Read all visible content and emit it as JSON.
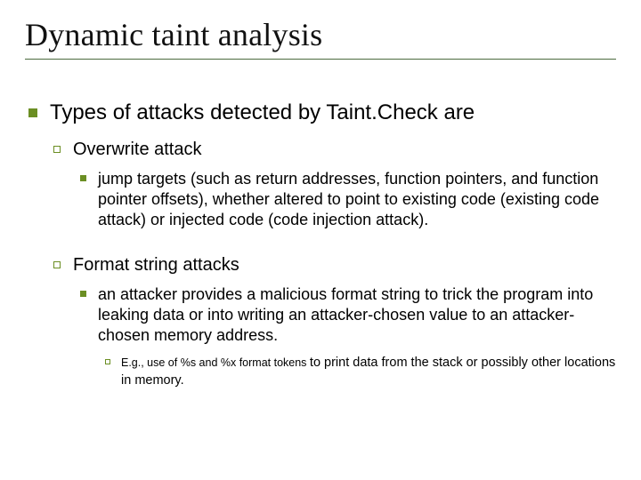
{
  "title": "Dynamic taint analysis",
  "bullets": {
    "level1": {
      "text": "Types of attacks detected by Taint.Check are",
      "children": [
        {
          "text": "Overwrite attack",
          "children": [
            {
              "text": "jump targets (such as return addresses, function pointers, and function pointer offsets), whether altered to point to existing code (existing code attack) or injected code (code injection attack)."
            }
          ]
        },
        {
          "text": "Format string attacks",
          "children": [
            {
              "text": "an attacker provides a malicious format string to trick the program into leaking data or into writing an attacker-chosen value to an attacker-chosen memory address.",
              "children": [
                {
                  "prefix": "E.g., use of %s and %x format tokens ",
                  "text": "to print data from the stack or possibly other locations in memory."
                }
              ]
            }
          ]
        }
      ]
    }
  }
}
